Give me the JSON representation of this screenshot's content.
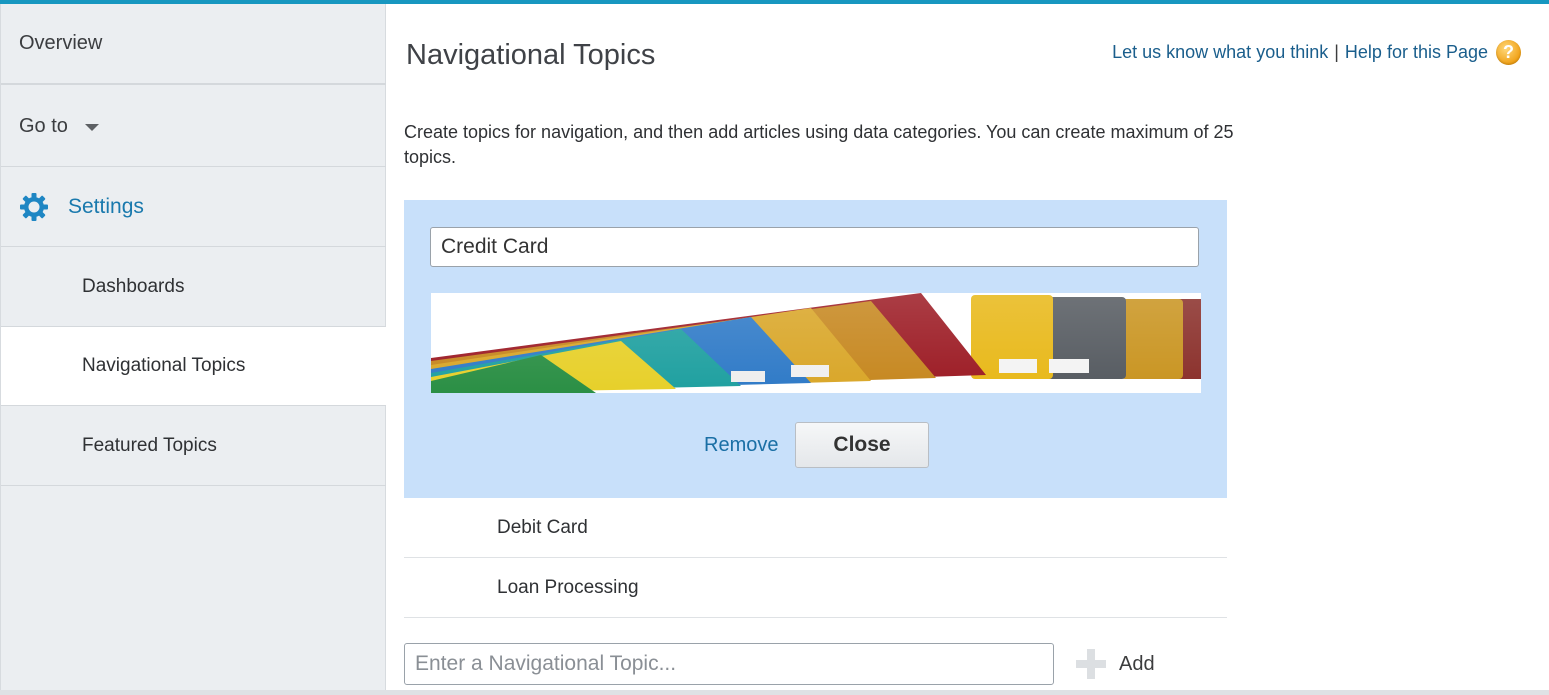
{
  "sidebar": {
    "overview": "Overview",
    "goto": "Go to",
    "settings": "Settings",
    "items": [
      {
        "label": "Dashboards"
      },
      {
        "label": "Navigational Topics"
      },
      {
        "label": "Featured Topics"
      }
    ]
  },
  "header": {
    "title": "Navigational Topics",
    "feedback_link": "Let us know what you think",
    "separator": "|",
    "help_link": "Help for this Page",
    "help_icon": "?"
  },
  "description": "Create topics for navigation, and then add articles using data categories. You can create maximum of 25 topics.",
  "editor": {
    "topic_value": "Credit Card",
    "remove_label": "Remove",
    "close_label": "Close"
  },
  "topics": [
    {
      "label": "Debit Card"
    },
    {
      "label": "Loan Processing"
    }
  ],
  "add": {
    "placeholder": "Enter a Navigational Topic...",
    "button_label": "Add"
  },
  "colors": {
    "accent": "#1797c0",
    "link": "#1a5e8c",
    "editor_bg": "#c8e0fa",
    "sidebar_bg": "#ebeef1"
  }
}
